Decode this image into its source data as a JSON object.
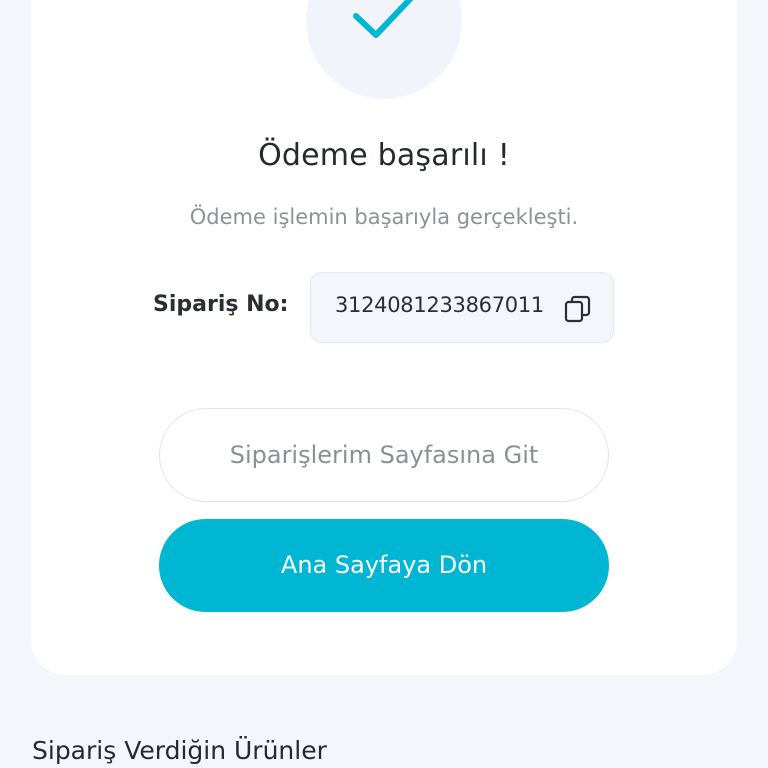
{
  "status": {
    "icon": "check-icon",
    "title": "Ödeme başarılı !",
    "subtitle": "Ödeme işlemin başarıyla gerçekleşti."
  },
  "order": {
    "label": "Sipariş No:",
    "number": "3124081233867011",
    "copy_icon": "copy-icon"
  },
  "actions": {
    "orders_page_label": "Siparişlerim Sayfasına Git",
    "home_label": "Ana Sayfaya Dön"
  },
  "section": {
    "ordered_products_title": "Sipariş Verdiğin Ürünler"
  },
  "colors": {
    "accent": "#00b6d3",
    "background": "#f3f6fa",
    "card": "#ffffff",
    "text_dark": "#262a30",
    "text_muted": "#8d9198"
  }
}
